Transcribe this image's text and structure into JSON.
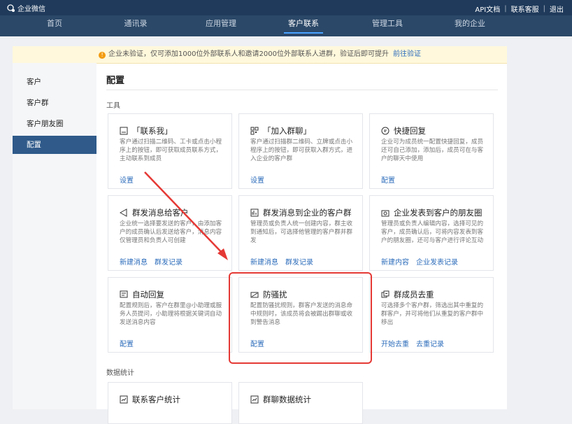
{
  "app": {
    "logo_text": "企业微信",
    "top_links": [
      "API文档",
      "联系客服",
      "退出"
    ]
  },
  "nav": {
    "items": [
      "首页",
      "通讯录",
      "应用管理",
      "客户联系",
      "管理工具",
      "我的企业"
    ],
    "active_index": 3
  },
  "notice": {
    "text": "企业未验证，仅可添加1000位外部联系人和邀请2000位外部联系人进群，验证后即可提升",
    "link": "前往验证"
  },
  "sidebar": {
    "items": [
      "客户",
      "客户群",
      "客户朋友圈",
      "配置"
    ],
    "active_index": 3
  },
  "main": {
    "title": "配置",
    "section_tools": "工具",
    "section_stats": "数据统计"
  },
  "cards": [
    {
      "icon": "qrcode-card-icon",
      "title": "「联系我」",
      "desc": "客户通过扫描二维码、工卡或点击小程序上的按钮，即可获取成员联系方式，主动联系到成员",
      "links": [
        "设置"
      ]
    },
    {
      "icon": "group-qrcode-icon",
      "title": "「加入群聊」",
      "desc": "客户通过扫描群二维码、立牌或点击小程序上的按钮，即可获取入群方式，进入企业的客户群",
      "links": [
        "设置"
      ]
    },
    {
      "icon": "chat-bubble-icon",
      "title": "快捷回复",
      "desc": "企业可为成员统一配置快捷回复，成员还可自己添加，添加后，成员可在与客户的聊天中使用",
      "links": [
        "配置"
      ]
    },
    {
      "icon": "megaphone-icon",
      "title": "群发消息给客户",
      "desc": "企业统一选择要发送的客户，由添加客户的成员确认后发送给客户，消息内容仅管理员和负责人可创建",
      "links": [
        "新建消息",
        "群发记录"
      ]
    },
    {
      "icon": "broadcast-icon",
      "title": "群发消息到企业的客户群",
      "desc": "管理员或负责人统一创建内容，群主收到通知后，可选择他管理的客户群并群发",
      "links": [
        "新建消息",
        "群发记录"
      ]
    },
    {
      "icon": "camera-icon",
      "title": "企业发表到客户的朋友圈",
      "desc": "管理员或负责人编辑内容，选择可见的客户，成员确认后，可将内容发表到客户的朋友圈，还可与客户进行评论互动",
      "links": [
        "新建内容",
        "企业发表记录"
      ]
    },
    {
      "icon": "auto-reply-icon",
      "title": "自动回复",
      "desc": "配置规则后，客户在群里@小助理或服务人员提问，小助理将根据关键词自动发送消息内容",
      "links": [
        "配置"
      ]
    },
    {
      "icon": "anti-harass-icon",
      "title": "防骚扰",
      "desc": "配置防骚扰规则，群客户发送的消息命中规则时，该成员将会被踢出群聊或收到警告消息",
      "links": [
        "配置"
      ]
    },
    {
      "icon": "dedupe-members-icon",
      "title": "群成员去重",
      "desc": "可选择多个客户群，筛选出其中重复的群客户，并可将他们从重复的客户群中移出",
      "links": [
        "开始去重",
        "去重记录"
      ]
    }
  ],
  "stat_cards": [
    {
      "icon": "stats-icon",
      "title": "联系客户统计"
    },
    {
      "icon": "stats-icon",
      "title": "群聊数据统计"
    }
  ],
  "colors": {
    "topbar": "#1f3a5b",
    "navbar": "#2b4868",
    "sidebar_active": "#2f5a8a",
    "link": "#2d6dbb",
    "highlight": "#e53935"
  }
}
